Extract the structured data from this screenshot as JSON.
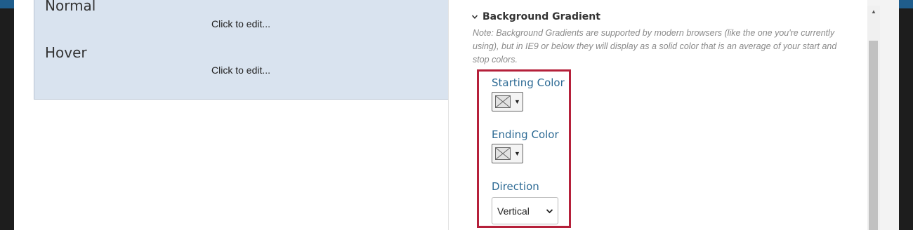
{
  "preview": {
    "states": [
      {
        "label": "Normal",
        "edit": "Click to edit..."
      },
      {
        "label": "Hover",
        "edit": "Click to edit..."
      }
    ]
  },
  "settings": {
    "section_title": "Background Gradient",
    "note": "Note: Background Gradients are supported by modern browsers (like the one you're currently using), but in IE9 or below they will display as a solid color that is an average of your start and stop colors.",
    "starting_color_label": "Starting Color",
    "ending_color_label": "Ending Color",
    "direction_label": "Direction",
    "direction_value": "Vertical"
  },
  "colors": {
    "preview_bg": "#d9e3ef",
    "label_blue": "#2e6b95",
    "highlight_red": "#b5203a"
  },
  "icons": {
    "section_toggle": "chevron-down-icon",
    "swatch": "no-color-swatch-icon",
    "scroll_up": "scroll-up-arrow-icon"
  }
}
